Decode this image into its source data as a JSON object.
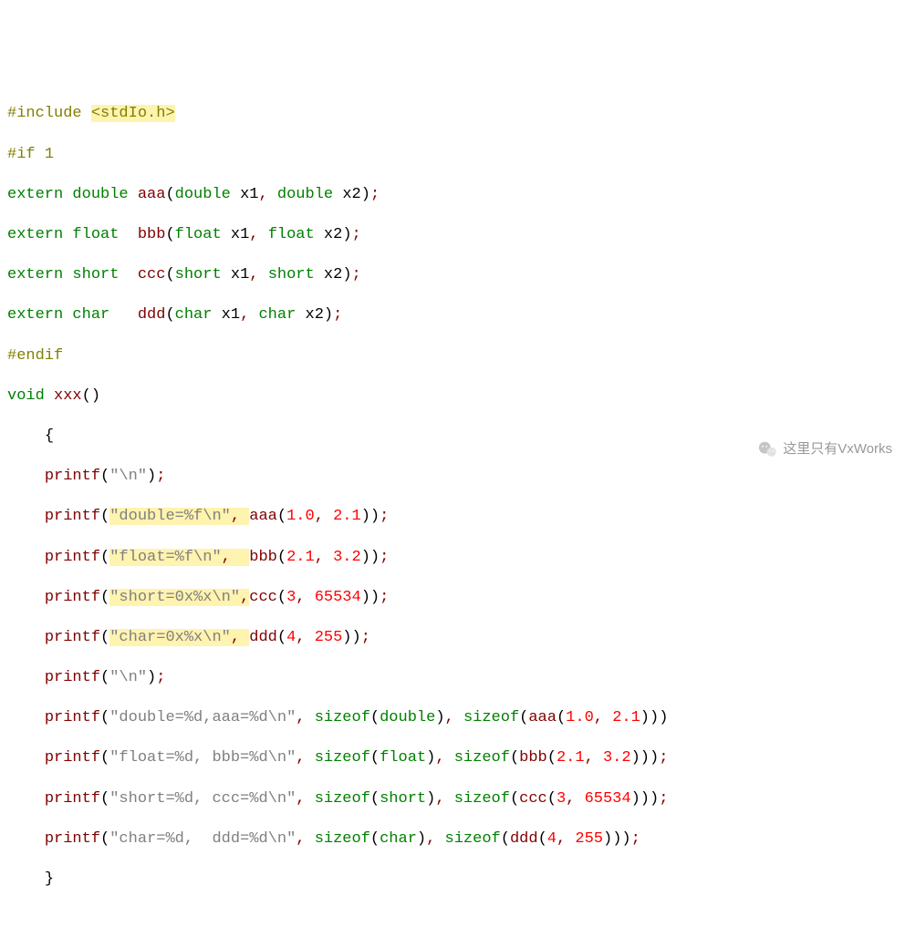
{
  "code": {
    "include_directive": "#include",
    "include_header": "<stdIo.h>",
    "if_directive": "#if",
    "if_cond": "1",
    "endif_directive": "#endif",
    "kw_extern": "extern",
    "kw_double": "double",
    "kw_float": "float",
    "kw_short": "short",
    "kw_char": "char",
    "kw_void": "void",
    "kw_sizeof": "sizeof",
    "fn_aaa": "aaa",
    "fn_bbb": "bbb",
    "fn_ccc": "ccc",
    "fn_ddd": "ddd",
    "fn_xxx": "xxx",
    "fn_printf": "printf",
    "id_x1": "x1",
    "id_x2": "x2",
    "str_nl": "\"\\n\"",
    "str_double_f": "\"double=%f\\n\"",
    "str_float_f": "\"float=%f\\n\"",
    "str_short_hex": "\"short=0x%x\\n\"",
    "str_char_hex": "\"char=0x%x\\n\"",
    "str_double_sz": "\"double=%d,aaa=%d\\n\"",
    "str_float_sz": "\"float=%d, bbb=%d\\n\"",
    "str_short_sz": "\"short=%d, ccc=%d\\n\"",
    "str_char_sz": "\"char=%d,  ddd=%d\\n\"",
    "num_1_0": "1.0",
    "num_2_1": "2.1",
    "num_3_2": "3.2",
    "num_3": "3",
    "num_4": "4",
    "num_65534": "65534",
    "num_255": "255",
    "comma": ", ",
    "comma_tight": ",",
    "semi": ";",
    "lparen": "(",
    "rparen": ")",
    "lbrace": "{",
    "rbrace": "}"
  },
  "watermark": {
    "text": "这里只有VxWorks"
  }
}
